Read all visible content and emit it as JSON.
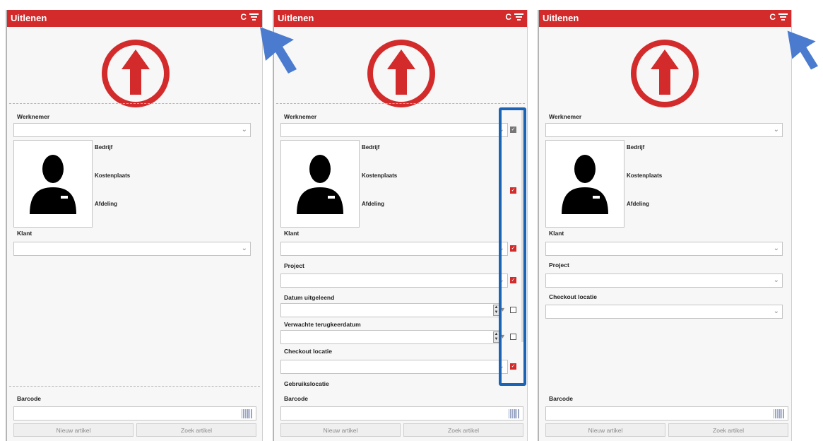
{
  "app": {
    "title": "Uitlenen",
    "reset_label": "C"
  },
  "colors": {
    "accent": "#d32b2b",
    "highlight": "#1b63b5",
    "cursor": "#4a7bcf"
  },
  "icons": {
    "filter": "filter-icon",
    "logo": "upload-arrow-icon",
    "avatar": "person-icon",
    "barcode": "barcode-icon"
  },
  "fields": {
    "werknemer": "Werknemer",
    "bedrijf": "Bedrijf",
    "kostenplaats": "Kostenplaats",
    "afdeling": "Afdeling",
    "klant": "Klant",
    "project": "Project",
    "datum_uitgeleend": "Datum uitgeleend",
    "verwachte_terugkeerdatum": "Verwachte terugkeerdatum",
    "checkout_locatie": "Checkout locatie",
    "gebruikslocatie": "Gebruikslocatie",
    "barcode": "Barcode"
  },
  "buttons": {
    "nieuw_artikel": "Nieuw artikel",
    "zoek_artikel": "Zoek artikel"
  },
  "panels": [
    {
      "name": "default-view",
      "visible_fields": [
        "Werknemer",
        "Klant"
      ]
    },
    {
      "name": "filter-settings",
      "visible_fields": [
        "Werknemer",
        "Klant",
        "Project",
        "Datum uitgeleend",
        "Verwachte terugkeerdatum",
        "Checkout locatie",
        "Gebruikslocatie"
      ],
      "checkboxes": [
        {
          "field": "Werknemer",
          "checked": true,
          "disabled": true
        },
        {
          "field": "Kostenplaats",
          "checked": true
        },
        {
          "field": "Klant",
          "checked": true
        },
        {
          "field": "Project",
          "checked": true
        },
        {
          "field": "Datum uitgeleend",
          "checked": false
        },
        {
          "field": "Verwachte terugkeerdatum",
          "checked": false
        },
        {
          "field": "Checkout locatie",
          "checked": true
        }
      ]
    },
    {
      "name": "filtered-view",
      "visible_fields": [
        "Werknemer",
        "Klant",
        "Project",
        "Checkout locatie"
      ]
    }
  ]
}
